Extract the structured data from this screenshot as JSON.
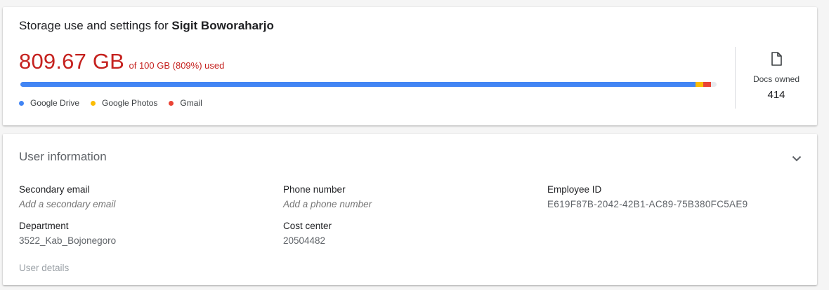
{
  "storage": {
    "title_prefix": "Storage use and settings for",
    "user_name": "Sigit Boworaharjo",
    "used_amount": "809.67 GB",
    "used_detail": "of 100 GB (809%) used",
    "used_color": "#c5221f",
    "bar": {
      "segments": [
        {
          "name": "Google Drive",
          "fraction": 0.97,
          "color": "#4285f4"
        },
        {
          "name": "Google Photos",
          "fraction": 0.011,
          "color": "#fbbc04"
        },
        {
          "name": "Gmail",
          "fraction": 0.011,
          "color": "#ea4335"
        }
      ]
    },
    "legend": [
      {
        "label": "Google Drive",
        "color": "#4285f4"
      },
      {
        "label": "Google Photos",
        "color": "#fbbc04"
      },
      {
        "label": "Gmail",
        "color": "#ea4335"
      }
    ],
    "docs": {
      "icon": "document-icon",
      "label": "Docs owned",
      "count": "414"
    }
  },
  "user_info": {
    "title": "User information",
    "expand_icon": "chevron-down-icon",
    "fields": {
      "secondary_email": {
        "label": "Secondary email",
        "value": "Add a secondary email"
      },
      "phone_number": {
        "label": "Phone number",
        "value": "Add a phone number"
      },
      "employee_id": {
        "label": "Employee ID",
        "value": "E619F87B-2042-42B1-AC89-75B380FC5AE9"
      },
      "department": {
        "label": "Department",
        "value": "3522_Kab_Bojonegoro"
      },
      "cost_center": {
        "label": "Cost center",
        "value": "20504482"
      }
    },
    "details_link": "User details"
  }
}
